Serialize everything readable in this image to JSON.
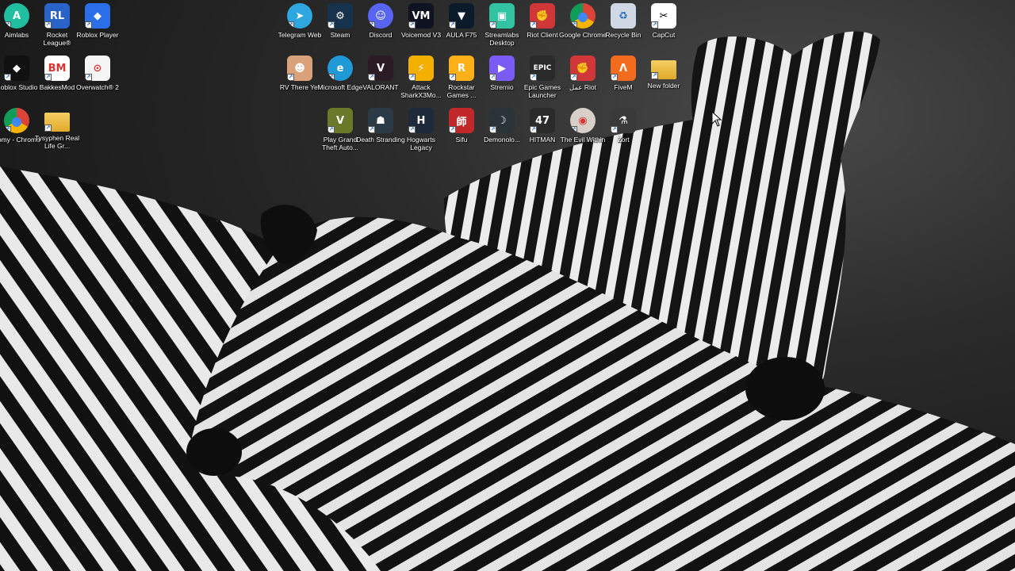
{
  "desktop": {
    "icons": [
      {
        "label": "Aimlabs",
        "icon": "aimlabs-icon",
        "color": "#1fbfa0",
        "glyph": "A"
      },
      {
        "label": "Rocket League®",
        "icon": "rocket-league-icon",
        "color": "#2a63c8",
        "glyph": "RL"
      },
      {
        "label": "Roblox Player",
        "icon": "roblox-player-icon",
        "color": "#2a6fe8",
        "glyph": "◆"
      },
      {
        "label": "Roblox Studio",
        "icon": "roblox-studio-icon",
        "color": "#111111",
        "glyph": "◆"
      },
      {
        "label": "BakkesMod",
        "icon": "bakkesmod-icon",
        "color": "#ffffff",
        "glyph": "BM"
      },
      {
        "label": "Overwatch® 2",
        "icon": "overwatch-icon",
        "color": "#f5f5f5",
        "glyph": "⊙"
      },
      {
        "label": "Somy - Chrome",
        "icon": "chrome-icon",
        "color": "#e8e8e8",
        "glyph": "●"
      },
      {
        "label": "Tysyphen Real Life Gr...",
        "icon": "folder-icon",
        "color": "#f2c14a",
        "glyph": ""
      },
      {
        "label": "Telegram Web",
        "icon": "telegram-icon",
        "color": "#2ea6e0",
        "glyph": "➤"
      },
      {
        "label": "Steam",
        "icon": "steam-icon",
        "color": "#16324c",
        "glyph": "⚙"
      },
      {
        "label": "Discord",
        "icon": "discord-icon",
        "color": "#5865f2",
        "glyph": "☺"
      },
      {
        "label": "Voicemod V3",
        "icon": "voicemod-icon",
        "color": "#0f1220",
        "glyph": "VM"
      },
      {
        "label": "AULA F75",
        "icon": "aula-icon",
        "color": "#0b1b2a",
        "glyph": "▼"
      },
      {
        "label": "Streamlabs Desktop",
        "icon": "streamlabs-icon",
        "color": "#31c3a2",
        "glyph": "▣"
      },
      {
        "label": "Riot Client",
        "icon": "riot-client-icon",
        "color": "#d13639",
        "glyph": "✊"
      },
      {
        "label": "Google Chrome",
        "icon": "chrome-icon",
        "color": "#e8e8e8",
        "glyph": "●"
      },
      {
        "label": "Recycle Bin",
        "icon": "recycle-bin-icon",
        "color": "#cfd8e3",
        "glyph": "♻"
      },
      {
        "label": "CapCut",
        "icon": "capcut-icon",
        "color": "#ffffff",
        "glyph": "✂"
      },
      {
        "label": "RV There Yet",
        "icon": "rv-there-yet-icon",
        "color": "#d9a27a",
        "glyph": "☻"
      },
      {
        "label": "Microsoft Edge",
        "icon": "edge-icon",
        "color": "#1f9ad6",
        "glyph": "e"
      },
      {
        "label": "VALORANT",
        "icon": "valorant-icon",
        "color": "#2a1b24",
        "glyph": "V"
      },
      {
        "label": "Attack SharkX3Mo...",
        "icon": "attack-shark-icon",
        "color": "#f3b000",
        "glyph": "⚡"
      },
      {
        "label": "Rockstar Games ...",
        "icon": "rockstar-icon",
        "color": "#fcaf17",
        "glyph": "R"
      },
      {
        "label": "Stremio",
        "icon": "stremio-icon",
        "color": "#7b5bf5",
        "glyph": "▶"
      },
      {
        "label": "Epic Games Launcher",
        "icon": "epic-games-icon",
        "color": "#2a2a2a",
        "glyph": "EPIC"
      },
      {
        "label": "عمل Riot",
        "icon": "riot-icon",
        "color": "#d13639",
        "glyph": "✊"
      },
      {
        "label": "FiveM",
        "icon": "fivem-icon",
        "color": "#f36b1c",
        "glyph": "Λ"
      },
      {
        "label": "New folder",
        "icon": "folder-icon",
        "color": "#f2c14a",
        "glyph": ""
      },
      {
        "label": "Play Grand Theft Auto...",
        "icon": "gta-icon",
        "color": "#6a7a2a",
        "glyph": "V"
      },
      {
        "label": "Death Stranding",
        "icon": "death-stranding-icon",
        "color": "#2c3a46",
        "glyph": "☗"
      },
      {
        "label": "Hogwarts Legacy",
        "icon": "hogwarts-icon",
        "color": "#1e2a3a",
        "glyph": "H"
      },
      {
        "label": "Sifu",
        "icon": "sifu-icon",
        "color": "#c0282a",
        "glyph": "師"
      },
      {
        "label": "Demonolo...",
        "icon": "demonologist-icon",
        "color": "#2a3438",
        "glyph": "☽"
      },
      {
        "label": "HITMAN",
        "icon": "hitman-icon",
        "color": "#2a2a2a",
        "glyph": "47"
      },
      {
        "label": "The Evil Within",
        "icon": "evil-within-icon",
        "color": "#d8d0c8",
        "glyph": "◉"
      },
      {
        "label": "Zort",
        "icon": "zort-icon",
        "color": "#3a3a3a",
        "glyph": "⚗"
      }
    ]
  }
}
